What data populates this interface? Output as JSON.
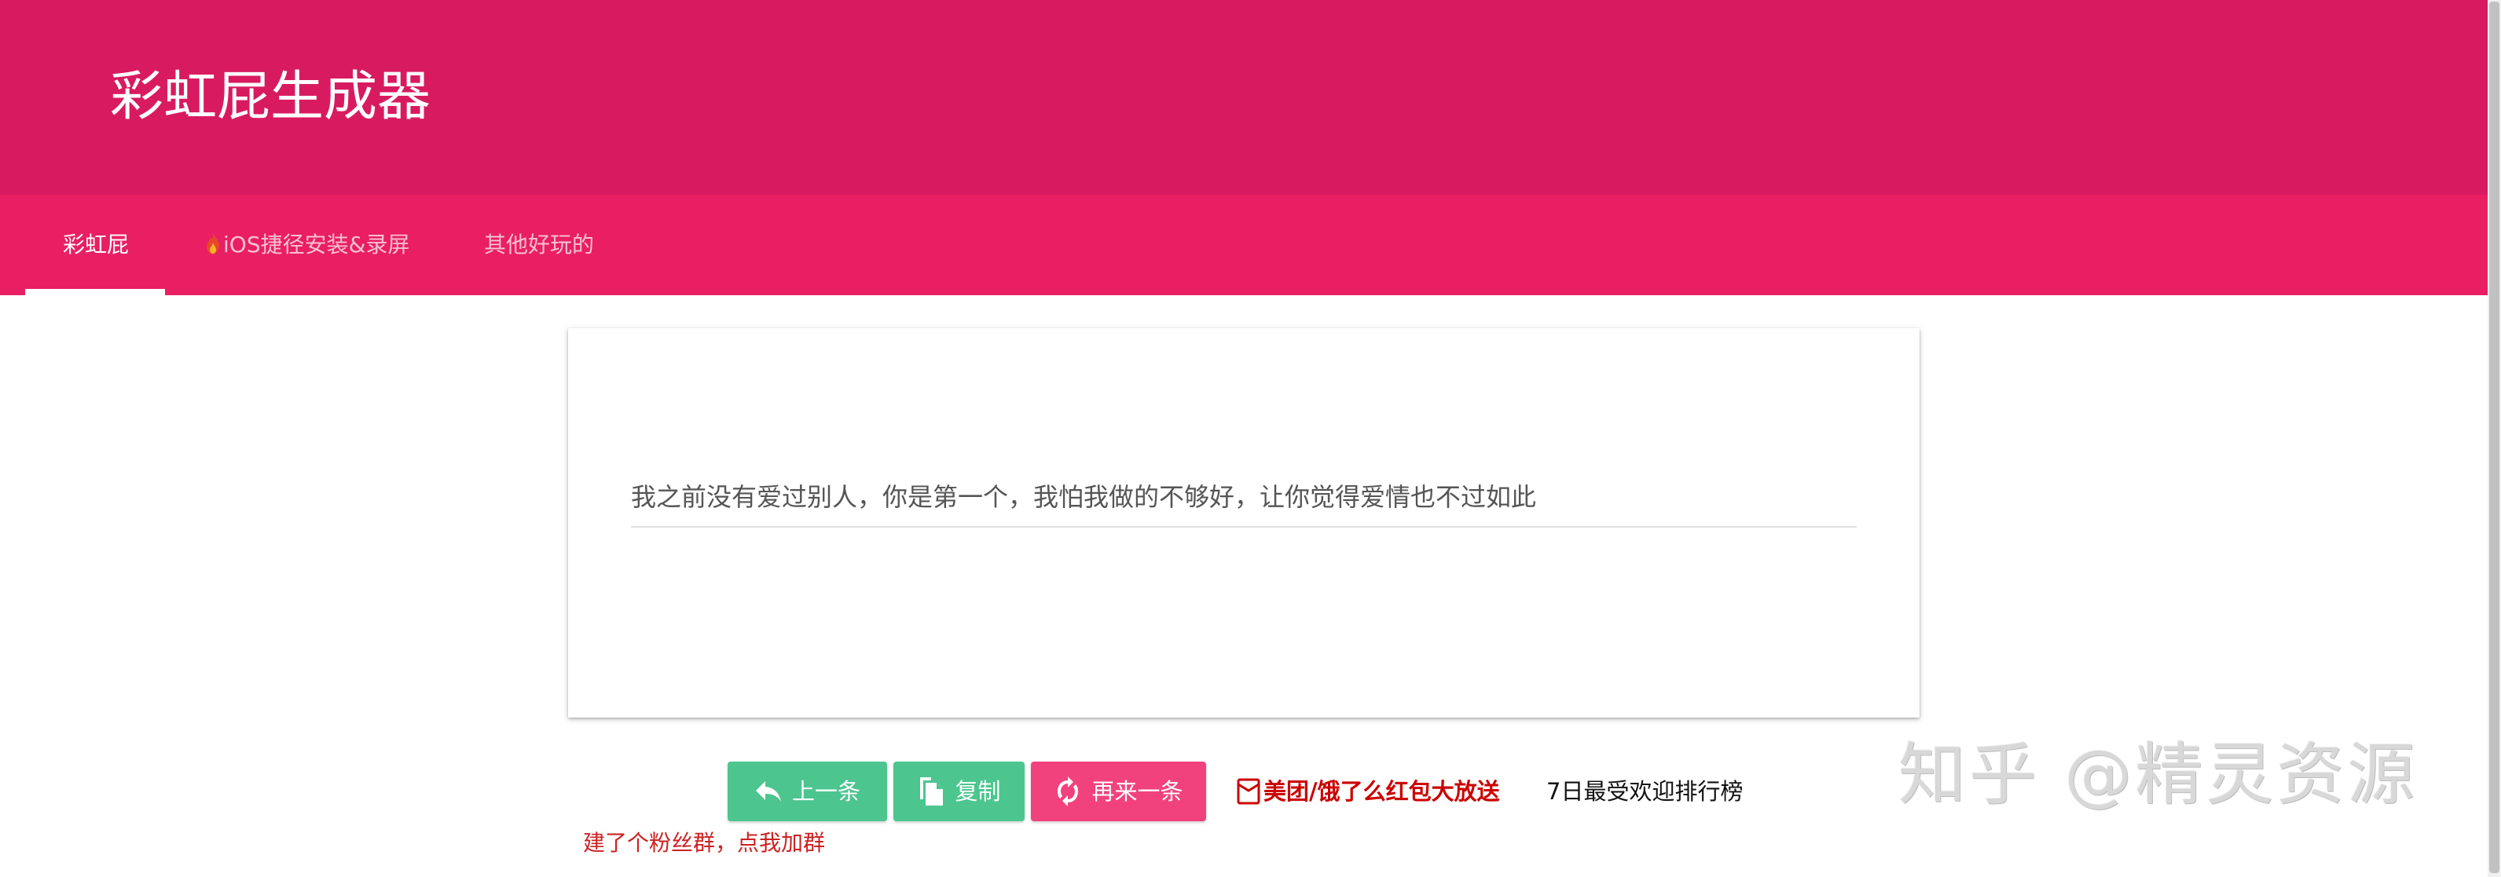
{
  "header": {
    "title": "彩虹屁生成器",
    "color": "#d81b60"
  },
  "tabs": [
    {
      "label": "彩虹屁",
      "active": true
    },
    {
      "label": "iOS捷径安装&录屏",
      "icon": "fire-icon"
    },
    {
      "label": "其他好玩的"
    }
  ],
  "card": {
    "compliment": "我之前没有爱过别人，你是第一个，我怕我做的不够好，让你觉得爱情也不过如此"
  },
  "actions": {
    "prev_label": "上一条",
    "copy_label": "复制",
    "next_label": "再来一条",
    "promo_label": "美团/饿了么红包大放送",
    "ranking_label": "7日最受欢迎排行榜"
  },
  "fan_group_label": "建了个粉丝群，点我加群",
  "watermark": "知乎 @精灵资源",
  "colors": {
    "accent": "#e91e63",
    "green_button": "#4cc58f",
    "pink_button": "#f2427d",
    "promo_red": "#cc0000"
  }
}
